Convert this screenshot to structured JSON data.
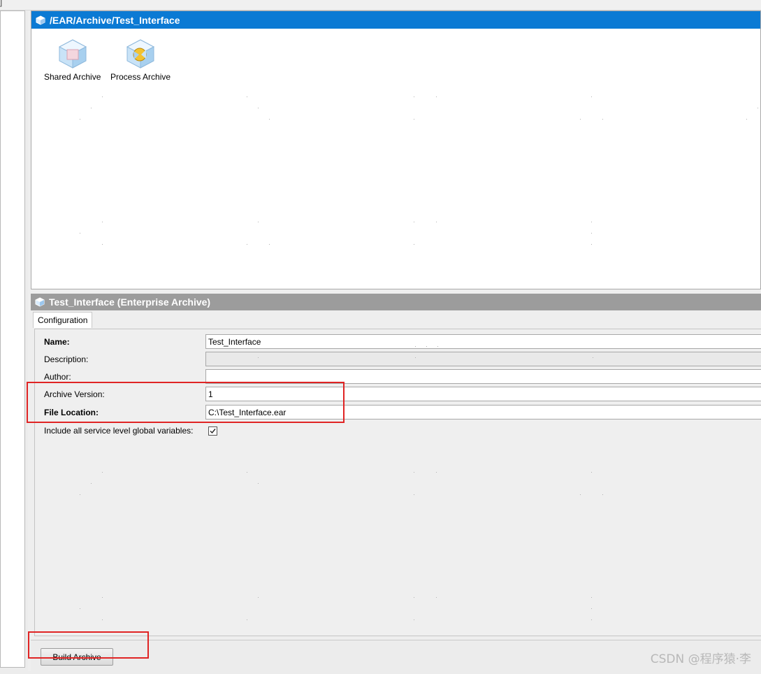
{
  "canvas": {
    "title": "/EAR/Archive/Test_Interface",
    "resources": [
      {
        "label": "Shared Archive",
        "icon": "shared-archive-icon"
      },
      {
        "label": "Process Archive",
        "icon": "process-archive-icon"
      }
    ]
  },
  "config": {
    "title": "Test_Interface (Enterprise Archive)",
    "tab_label": "Configuration",
    "fields": {
      "name_label": "Name:",
      "name_value": "Test_Interface",
      "description_label": "Description:",
      "description_value": "",
      "author_label": "Author:",
      "author_value": "",
      "archive_version_label": "Archive Version:",
      "archive_version_value": "1",
      "file_location_label": "File Location:",
      "file_location_value": "C:\\Test_Interface.ear",
      "include_globals_label": "Include all service level global variables:",
      "include_globals_checked": true
    },
    "build_button_label": "Build Archive"
  },
  "watermark": "CSDN @程序猿·李",
  "colors": {
    "title_blue": "#0b7ad4",
    "title_gray": "#9c9c9c",
    "highlight_red": "#e02424"
  }
}
